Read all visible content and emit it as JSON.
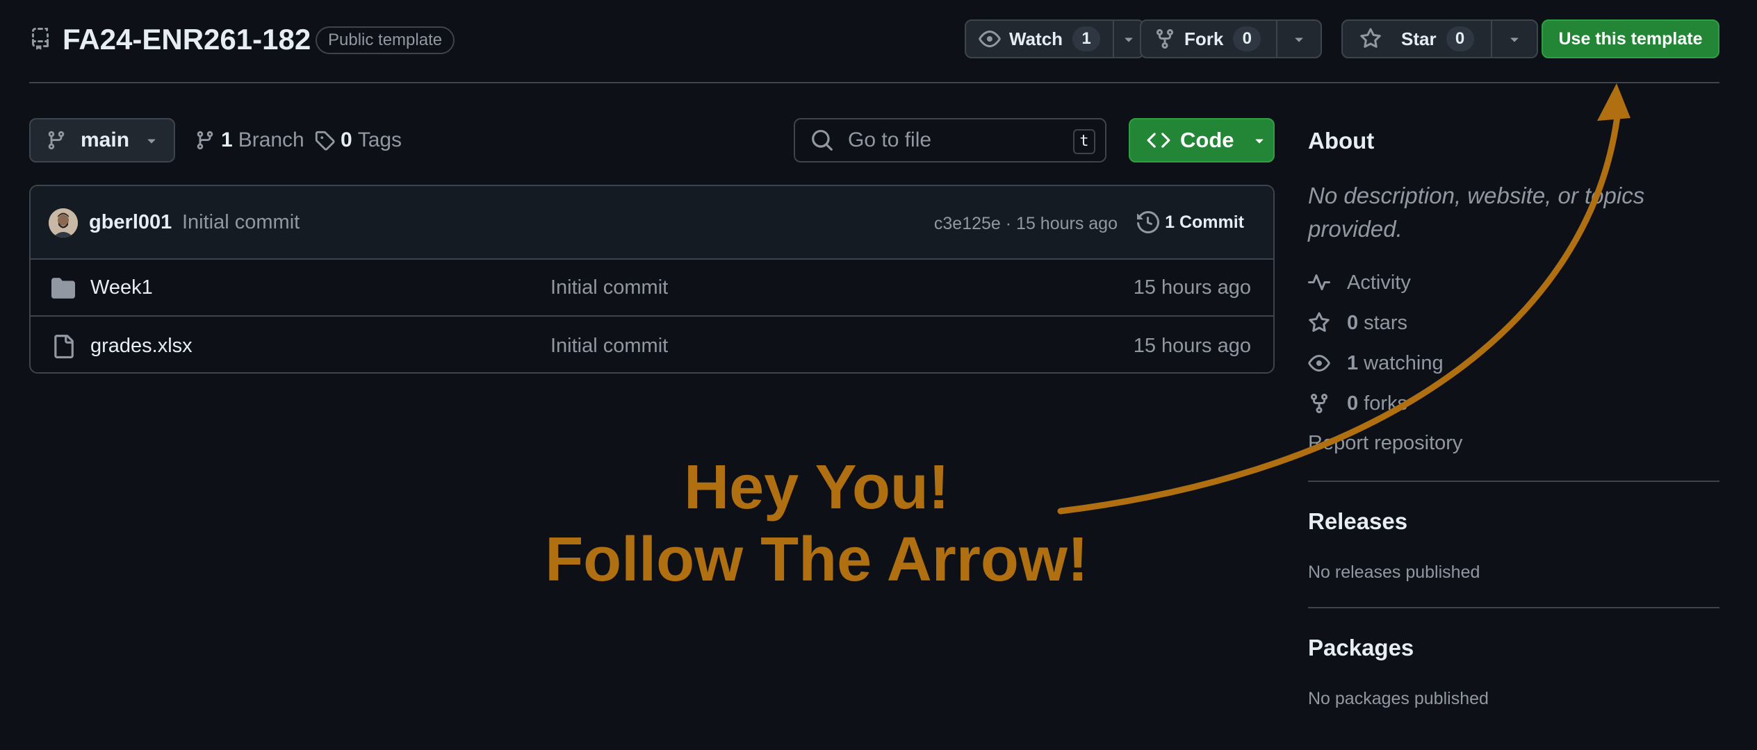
{
  "header": {
    "repo_name": "FA24-ENR261-182",
    "visibility_badge": "Public template",
    "watch": {
      "label": "Watch",
      "count": "1"
    },
    "fork": {
      "label": "Fork",
      "count": "0"
    },
    "star": {
      "label": "Star",
      "count": "0"
    },
    "use_template_label": "Use this template"
  },
  "toolbar": {
    "branch_name": "main",
    "branch_count": "1",
    "branch_label": "Branch",
    "tag_count": "0",
    "tag_label": "Tags",
    "search_placeholder": "Go to file",
    "search_shortcut": "t",
    "code_label": "Code"
  },
  "commit": {
    "author": "gberl001",
    "message": "Initial commit",
    "sha_time": "c3e125e · 15 hours ago",
    "count_label": "1 Commit"
  },
  "files": [
    {
      "name": "Week1",
      "type": "folder",
      "message": "Initial commit",
      "time": "15 hours ago"
    },
    {
      "name": "grades.xlsx",
      "type": "file",
      "message": "Initial commit",
      "time": "15 hours ago"
    }
  ],
  "sidebar": {
    "about_title": "About",
    "about_desc": "No description, website, or topics provided.",
    "activity_label": "Activity",
    "stars_count": "0",
    "stars_label": "stars",
    "watching_count": "1",
    "watching_label": "watching",
    "forks_count": "0",
    "forks_label": "forks",
    "report_label": "Report repository",
    "releases_title": "Releases",
    "releases_sub": "No releases published",
    "packages_title": "Packages",
    "packages_sub": "No packages published"
  },
  "annotation": {
    "line1": "Hey You!",
    "line2": "Follow The Arrow!",
    "color": "#b06f10"
  },
  "colors": {
    "background": "#0d1117",
    "accent_green": "#238636",
    "border": "#3d444d",
    "muted_text": "#9198a1"
  }
}
